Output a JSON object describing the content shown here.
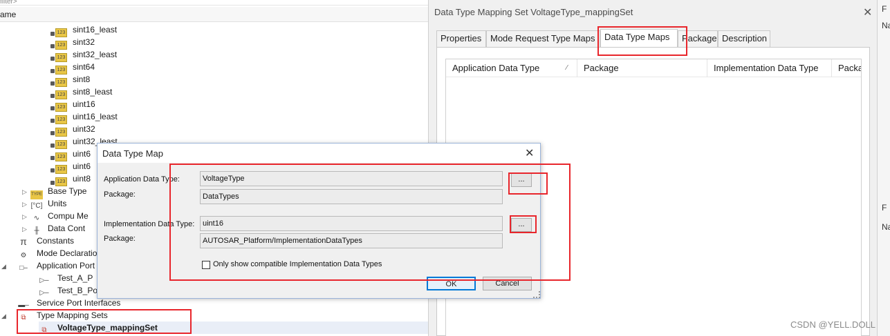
{
  "tree": {
    "filter_hint": "filter>",
    "name_header": "ame",
    "items": [
      {
        "label": "sint16_least"
      },
      {
        "label": "sint32"
      },
      {
        "label": "sint32_least"
      },
      {
        "label": "sint64"
      },
      {
        "label": "sint8"
      },
      {
        "label": "sint8_least"
      },
      {
        "label": "uint16"
      },
      {
        "label": "uint16_least"
      },
      {
        "label": "uint32"
      },
      {
        "label": "uint32_least"
      },
      {
        "label": "uint6"
      },
      {
        "label": "uint6"
      },
      {
        "label": "uint8"
      }
    ],
    "groups": [
      {
        "label": "Base Type",
        "icon": "TYPE"
      },
      {
        "label": "Units",
        "icon": "[°C]"
      },
      {
        "label": "Compu Me",
        "icon": "curve"
      },
      {
        "label": "Data Cont",
        "icon": "ruler"
      }
    ],
    "top_items": [
      {
        "label": "Constants",
        "icon": "π"
      },
      {
        "label": "Mode Declaratio",
        "icon": "mode"
      },
      {
        "label": "Application Port",
        "icon": "port"
      }
    ],
    "ports": [
      {
        "label": "Test_A_P"
      },
      {
        "label": "Test_B_Po"
      }
    ],
    "service": "Service Port Interfaces",
    "type_mapping": "Type Mapping Sets",
    "selected": "VoltageType_mappingSet"
  },
  "set_window": {
    "title": "Data Type Mapping Set VoltageType_mappingSet",
    "close": "✕",
    "tabs": [
      "Properties",
      "Mode Request Type Maps",
      "Data Type Maps",
      "Package",
      "Description"
    ],
    "active_tab": "Data Type Maps",
    "columns": [
      "Application Data Type",
      "Package",
      "Implementation Data Type",
      "Packa"
    ],
    "sort_glyph": "⁄"
  },
  "sliver": {
    "f1": "F",
    "n1": "Na",
    "f2": "F",
    "n2": "Na"
  },
  "dialog": {
    "title": "Data Type Map",
    "close": "✕",
    "app_type_label": "Application Data Type:",
    "app_type_value": "VoltageType",
    "app_pkg_label": "Package:",
    "app_pkg_value": "DataTypes",
    "impl_type_label": "Implementation Data Type:",
    "impl_type_value": "uint16",
    "impl_pkg_label": "Package:",
    "impl_pkg_value": "AUTOSAR_Platform/ImplementationDataTypes",
    "browse": "...",
    "checkbox_label": "Only show compatible Implementation Data Types",
    "ok": "OK",
    "cancel": "Cancel"
  },
  "watermark": "CSDN @YELL.DOLL",
  "colors": {
    "annotation_red": "#e8252b",
    "focus_blue": "#0078d7",
    "icon_yellow": "#e9c646"
  }
}
